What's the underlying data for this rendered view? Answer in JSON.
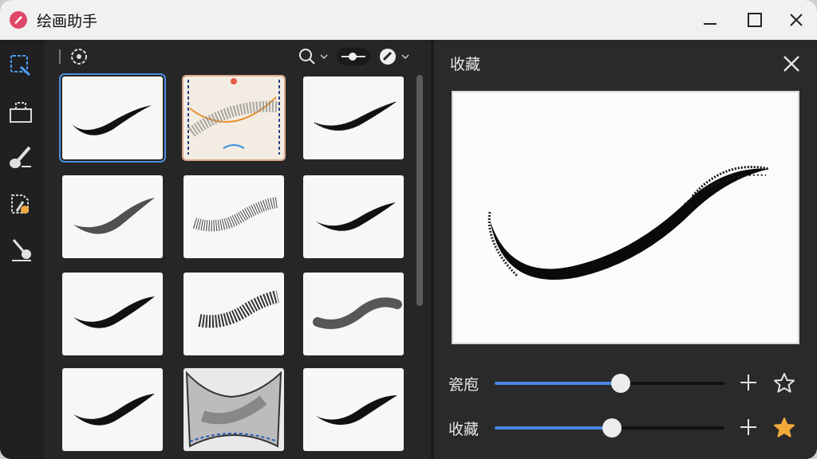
{
  "window": {
    "title": "绘画助手"
  },
  "detail": {
    "title": "收藏",
    "sliders": [
      {
        "label": "瓷庖",
        "value": 0.55,
        "favorited": false
      },
      {
        "label": "收藏",
        "value": 0.51,
        "favorited": true
      }
    ]
  },
  "colors": {
    "accent": "#4b86e5",
    "star": "#f2a93b"
  },
  "icons": {
    "rail": [
      "brush-select-icon",
      "bucket-icon",
      "paint-brush-icon",
      "color-brush-icon",
      "eraser-brush-icon"
    ],
    "toolbar": [
      "settings-icon",
      "search-icon",
      "size-slider-icon",
      "brush-check-icon"
    ]
  }
}
